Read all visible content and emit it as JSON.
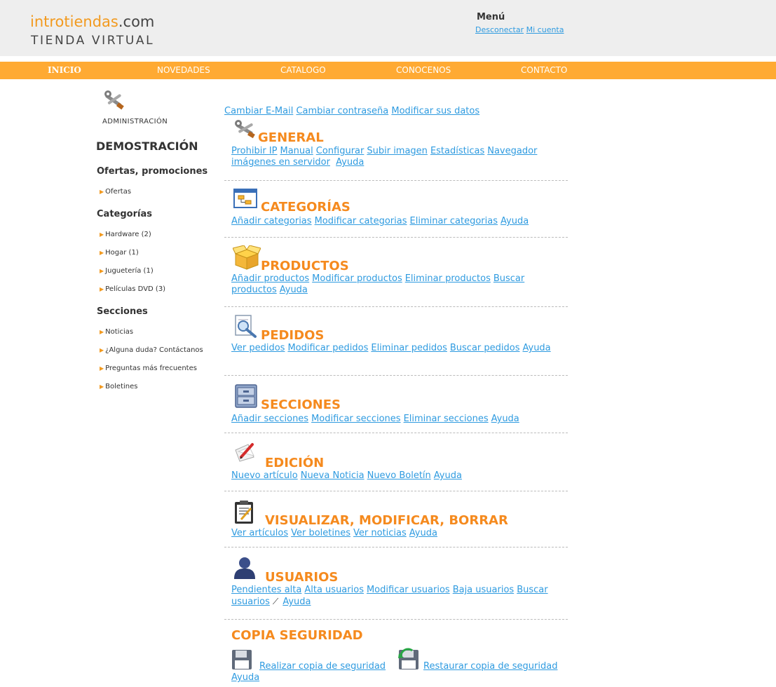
{
  "header": {
    "logo_part1": "introtiendas",
    "logo_part2": ".com",
    "logo_sub": "TIENDA VIRTUAL",
    "menu_title": "Menú",
    "logout_link": "Desconectar",
    "account_link": "Mi cuenta"
  },
  "nav": {
    "items": [
      {
        "label": "INICIO"
      },
      {
        "label": "NOVEDADES"
      },
      {
        "label": "CATALOGO"
      },
      {
        "label": "CONOCENOS"
      },
      {
        "label": "CONTACTO"
      }
    ]
  },
  "sidebar": {
    "admin_label": "ADMINISTRACIÓN",
    "demo_title": "DEMOSTRACIÓN",
    "offers_heading": "Ofertas, promociones",
    "offers_items": [
      {
        "label": "Ofertas"
      }
    ],
    "categories_heading": "Categorías",
    "categories_items": [
      {
        "label": "Hardware (2)"
      },
      {
        "label": "Hogar (1)"
      },
      {
        "label": "Juguetería (1)"
      },
      {
        "label": "Películas DVD (3)"
      }
    ],
    "sections_heading": "Secciones",
    "sections_items": [
      {
        "label": "Noticias"
      },
      {
        "label": "¿Alguna duda? Contáctanos"
      },
      {
        "label": "Preguntas más frecuentes"
      },
      {
        "label": "Boletines"
      }
    ]
  },
  "account_links": [
    "Cambiar E-Mail",
    "Cambiar contraseña",
    "Modificar sus datos"
  ],
  "sections": [
    {
      "title": "GENERAL",
      "icon": "tools-icon",
      "links": [
        "Prohibir IP",
        "Manual",
        "Configurar",
        "Subir imagen",
        "Estadísticas",
        "Navegador imágenes en servidor",
        "Ayuda"
      ]
    },
    {
      "title": "CATEGORÍAS",
      "icon": "category-tree-icon",
      "links": [
        "Añadir categorias",
        "Modificar categorias",
        "Eliminar categorias",
        "Ayuda"
      ]
    },
    {
      "title": "PRODUCTOS",
      "icon": "box-icon",
      "links": [
        "Añadir productos",
        "Modificar productos",
        "Eliminar productos",
        "Buscar productos",
        "Ayuda"
      ]
    },
    {
      "title": "PEDIDOS",
      "icon": "document-search-icon",
      "links": [
        "Ver pedidos",
        "Modificar pedidos",
        "Eliminar pedidos",
        "Buscar pedidos",
        "Ayuda"
      ]
    },
    {
      "title": "SECCIONES",
      "icon": "cabinet-icon",
      "links": [
        "Añadir secciones",
        "Modificar secciones",
        "Eliminar secciones",
        "Ayuda"
      ]
    },
    {
      "title": "EDICIÓN",
      "icon": "edit-pen-icon",
      "links": [
        "Nuevo artículo",
        "Nueva Noticia",
        "Nuevo Boletín",
        "Ayuda"
      ]
    },
    {
      "title": "VISUALIZAR, MODIFICAR, BORRAR",
      "icon": "clipboard-icon",
      "links": [
        "Ver artículos",
        "Ver boletines",
        "Ver noticias",
        "Ayuda"
      ]
    },
    {
      "title": "USUARIOS",
      "icon": "user-icon",
      "links": [
        "Pendientes alta",
        "Alta usuarios",
        "Modificar usuarios",
        "Baja usuarios",
        "Buscar usuarios",
        "Ayuda"
      ]
    }
  ],
  "backup": {
    "title": "COPIA SEGURIDAD",
    "make_backup": "Realizar copia de seguridad",
    "restore_backup": "Restaurar copia de seguridad",
    "help": "Ayuda"
  }
}
